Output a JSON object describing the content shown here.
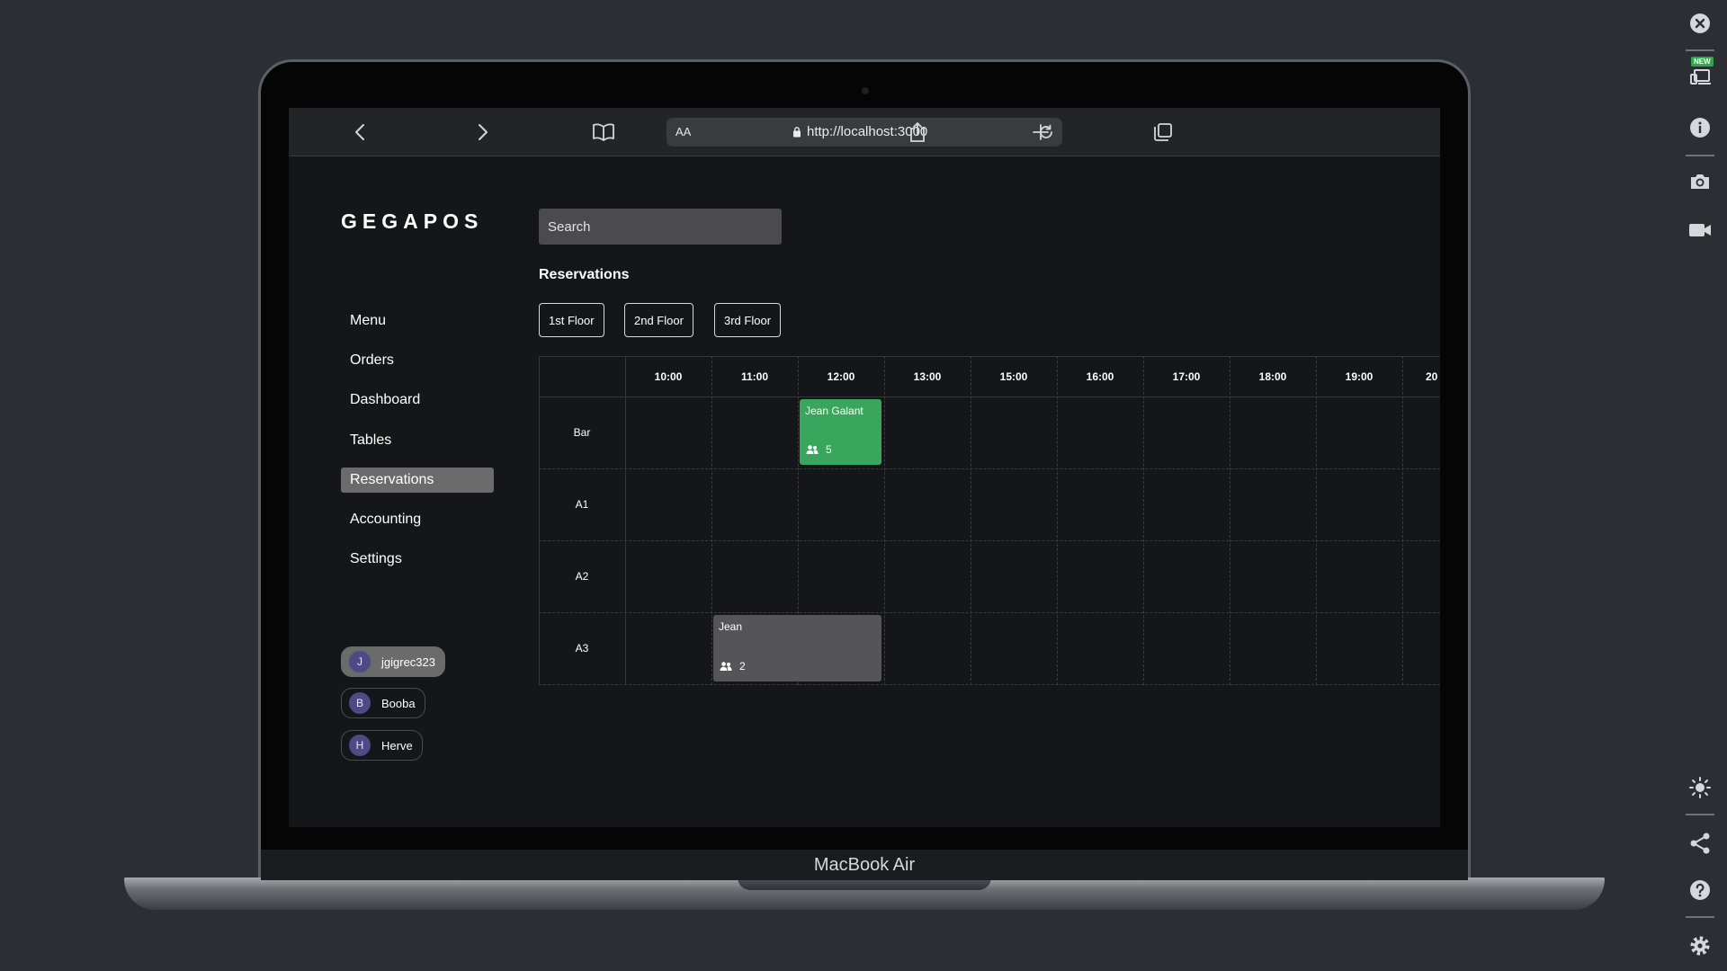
{
  "browser": {
    "text_size_label": "AA",
    "url": "http://localhost:3000"
  },
  "device_label": "MacBook Air",
  "tool_rail": {
    "new_badge": "NEW"
  },
  "app": {
    "brand": "GEGAPOS",
    "nav": [
      {
        "label": "Menu"
      },
      {
        "label": "Orders"
      },
      {
        "label": "Dashboard"
      },
      {
        "label": "Tables"
      },
      {
        "label": "Reservations",
        "active": true
      },
      {
        "label": "Accounting"
      },
      {
        "label": "Settings"
      }
    ],
    "users": [
      {
        "initial": "J",
        "name": "jgigrec323",
        "active": true
      },
      {
        "initial": "B",
        "name": "Booba"
      },
      {
        "initial": "H",
        "name": "Herve"
      }
    ],
    "search": {
      "placeholder": "Search",
      "value": ""
    },
    "section_title": "Reservations",
    "floors": [
      "1st Floor",
      "2nd Floor",
      "3rd Floor"
    ],
    "times": [
      "10:00",
      "11:00",
      "12:00",
      "13:00",
      "15:00",
      "16:00",
      "17:00",
      "18:00",
      "19:00",
      "20"
    ],
    "rows": [
      "Bar",
      "A1",
      "A2",
      "A3"
    ],
    "reservations": [
      {
        "name": "Jean Galant",
        "guests": "5",
        "row": "Bar",
        "start": "12:00",
        "color": "#3aa55c"
      },
      {
        "name": "Jean",
        "guests": "2",
        "row": "A3",
        "start": "11:00",
        "end": "12:00",
        "color": "#555558"
      }
    ],
    "colors": {
      "accent_green": "#3aa55c",
      "active_nav": "#6b6b6b",
      "avatar": "#4d4a86"
    }
  }
}
